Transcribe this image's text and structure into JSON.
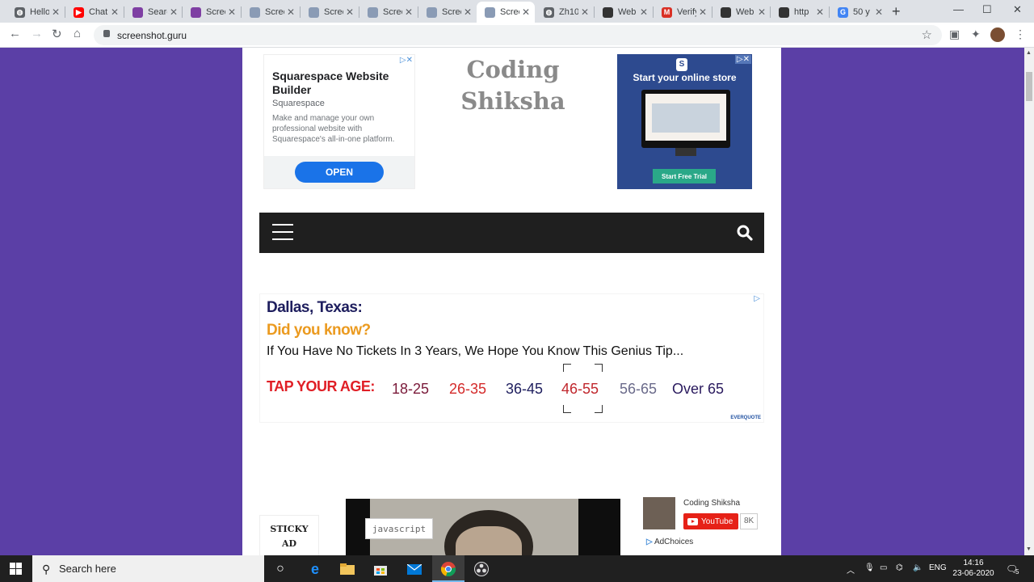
{
  "browser": {
    "tabs": [
      {
        "title": "Hello",
        "color": "#5f6368",
        "glyph": "◍",
        "active": false
      },
      {
        "title": "Chat",
        "color": "#ff0000",
        "glyph": "▶",
        "active": false
      },
      {
        "title": "Search",
        "color": "#7e3fa3",
        "glyph": "",
        "active": false
      },
      {
        "title": "Screen",
        "color": "#7e3fa3",
        "glyph": "",
        "active": false
      },
      {
        "title": "Screen",
        "color": "#8a9bb5",
        "glyph": "",
        "active": false
      },
      {
        "title": "Screen",
        "color": "#8a9bb5",
        "glyph": "",
        "active": false
      },
      {
        "title": "Screen",
        "color": "#8a9bb5",
        "glyph": "",
        "active": false
      },
      {
        "title": "Screen",
        "color": "#8a9bb5",
        "glyph": "",
        "active": false
      },
      {
        "title": "Screen",
        "color": "#8a9bb5",
        "glyph": "",
        "active": true
      },
      {
        "title": "Zh10",
        "color": "#5f6368",
        "glyph": "◍",
        "active": false
      },
      {
        "title": "Web",
        "color": "#333333",
        "glyph": "",
        "active": false
      },
      {
        "title": "Verify",
        "color": "#d93025",
        "glyph": "M",
        "active": false
      },
      {
        "title": "Web",
        "color": "#333333",
        "glyph": "",
        "active": false
      },
      {
        "title": "http",
        "color": "#333333",
        "glyph": "",
        "active": false
      },
      {
        "title": "50 y",
        "color": "#4285f4",
        "glyph": "G",
        "active": false
      }
    ],
    "url": "screenshot.guru"
  },
  "page": {
    "left_ad": {
      "headline": "Squarespace Website Builder",
      "brand": "Squarespace",
      "description": "Make and manage your own professional website with Squarespace's all-in-one platform.",
      "cta": "OPEN"
    },
    "site_title": "Coding Shiksha",
    "right_ad": {
      "headline": "Start your online store",
      "cta": "Start Free Trial"
    },
    "mid_ad": {
      "location": "Dallas, Texas:",
      "question": "Did you know?",
      "tip": "If You Have No Tickets In 3 Years, We Hope You Know This Genius Tip...",
      "tap_label": "TAP YOUR AGE:",
      "age_ranges": [
        {
          "label": "18-25",
          "color": "#7a1a3a"
        },
        {
          "label": "26-35",
          "color": "#d42a2a"
        },
        {
          "label": "36-45",
          "color": "#1e1e5e"
        },
        {
          "label": "46-55",
          "color": "#c0272d"
        },
        {
          "label": "56-65",
          "color": "#6a6a8a"
        },
        {
          "label": "Over 65",
          "color": "#2a1a5e"
        }
      ],
      "sponsor": "EVERQUOTE"
    },
    "sticky_label_1": "STICKY",
    "sticky_label_2": "AD",
    "video_tag": "javascript",
    "youtube_widget": {
      "channel": "Coding Shiksha",
      "button": "YouTube",
      "count": "8K",
      "adchoices": "AdChoices"
    }
  },
  "taskbar": {
    "search_placeholder": "Search here",
    "language": "ENG",
    "time": "14:16",
    "date": "23-06-2020",
    "notifications": "5"
  }
}
